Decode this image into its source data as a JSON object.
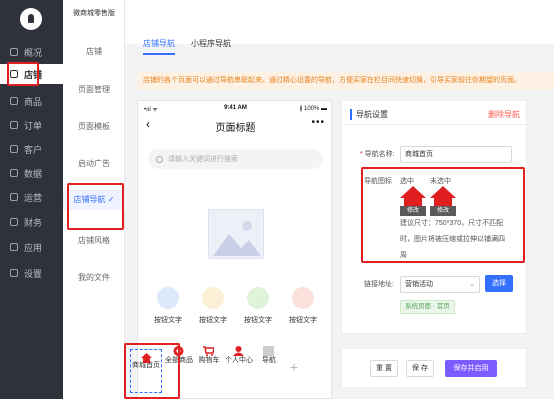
{
  "sidebar": {
    "items": [
      {
        "label": "概况"
      },
      {
        "label": "店铺"
      },
      {
        "label": "商品"
      },
      {
        "label": "订单"
      },
      {
        "label": "客户"
      },
      {
        "label": "数据"
      },
      {
        "label": "运营"
      },
      {
        "label": "财务"
      },
      {
        "label": "应用"
      },
      {
        "label": "设置"
      }
    ]
  },
  "subnav": {
    "store_name": "微商城零售版",
    "section": "店铺",
    "items": [
      {
        "label": "页面管理"
      },
      {
        "label": "页面模板"
      },
      {
        "label": "启动广告"
      },
      {
        "label": "店铺导航"
      },
      {
        "label": "店铺风格"
      },
      {
        "label": "我的文件"
      }
    ],
    "active_check": "✓"
  },
  "tabs": [
    {
      "label": "店铺导航",
      "active": true
    },
    {
      "label": "小程序导航",
      "active": false
    }
  ],
  "notice": "店铺的各个页面可以通过导航串联起来。通过精心设置的导航，方便买家在栏目间快速切换，引导买家前往你期望的页面。",
  "phone": {
    "status_left": "•ııl ᯤ",
    "time": "9:41 AM",
    "battery": "∦ 100% ▬",
    "title": "页面标题",
    "back": "‹",
    "more": "•••",
    "search_placeholder": "请输入关键词进行搜索",
    "buttons": [
      {
        "label": "按钮文字",
        "color": "#dce9fb"
      },
      {
        "label": "按钮文字",
        "color": "#fbefd6"
      },
      {
        "label": "按钮文字",
        "color": "#dff3d8"
      },
      {
        "label": "按钮文字",
        "color": "#fbe0dc"
      }
    ]
  },
  "tabbar": {
    "items": [
      {
        "label": "商城首页",
        "icon": "home-icon"
      },
      {
        "label": "全部商品",
        "icon": "grid-icon"
      },
      {
        "label": "购物车",
        "icon": "cart-icon"
      },
      {
        "label": "个人中心",
        "icon": "person-icon"
      },
      {
        "label": "导航",
        "icon": "nav-icon"
      }
    ],
    "plus": "+"
  },
  "settings": {
    "title": "导航设置",
    "delete": "删除导航",
    "name_label": "导航名称:",
    "name_value": "商城首页",
    "icon_label": "导航图标",
    "selected_label": "选中",
    "unselected_label": "未选中",
    "edit_label": "修改",
    "help_text_1": "建议尺寸：750*370，尺寸不匹配",
    "help_text_2": "时，图片将被压缩或拉伸以铺满四",
    "help_text_3": "周",
    "link_label": "链接地址:",
    "link_value": "营销活动",
    "choose": "选择",
    "link_tag": "系统页面 - 首页"
  },
  "footer": {
    "reset": "重 置",
    "save": "保 存",
    "save_enable": "保存并启用"
  },
  "colors": {
    "accent": "#3370ff",
    "highlight": "#e02020",
    "primary_button": "#7b5cff"
  }
}
